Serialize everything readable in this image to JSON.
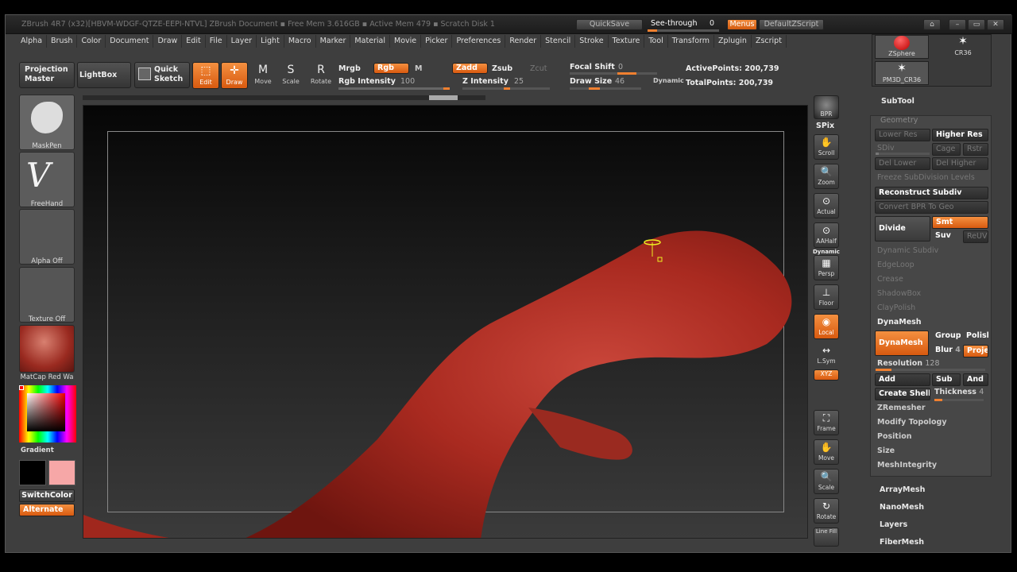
{
  "window_title": "ZBrush 4R7 (x32)[HBVM-WDGF-QTZE-EEPI-NTVL]    ZBrush Document    ▪ Free Mem 3.616GB ▪ Active Mem 479 ▪ Scratch Disk 1",
  "titlebar": {
    "quicksave": "QuickSave",
    "see_through": "See-through",
    "see_through_value": "0",
    "menus": "Menus",
    "default_zscript": "DefaultZScript"
  },
  "menu": [
    "Alpha",
    "Brush",
    "Color",
    "Document",
    "Draw",
    "Edit",
    "File",
    "Layer",
    "Light",
    "Macro",
    "Marker",
    "Material",
    "Movie",
    "Picker",
    "Preferences",
    "Render",
    "Stencil",
    "Stroke",
    "Texture",
    "Tool",
    "Transform",
    "Zplugin",
    "Zscript"
  ],
  "top_shelf": {
    "projection_master": [
      "Projection",
      "Master"
    ],
    "lightbox": "LightBox",
    "quick_sketch": [
      "Quick",
      "Sketch"
    ],
    "edit": "Edit",
    "draw": "Draw",
    "move": "Move",
    "scale": "Scale",
    "rotate": "Rotate",
    "mrgb": "Mrgb",
    "rgb": "Rgb",
    "m": "M",
    "rgb_intensity_label": "Rgb Intensity",
    "rgb_intensity_value": "100",
    "zadd": "Zadd",
    "zsub": "Zsub",
    "zcut": "Zcut",
    "z_intensity_label": "Z Intensity",
    "z_intensity_value": "25",
    "focal_shift_label": "Focal Shift",
    "focal_shift_value": "0",
    "draw_size_label": "Draw Size",
    "draw_size_value": "46",
    "dynamic": "Dynamic",
    "active_points": "ActivePoints: 200,739",
    "total_points": "TotalPoints: 200,739"
  },
  "left_tray": {
    "brush": "MaskPen",
    "stroke": "FreeHand",
    "alpha": "Alpha Off",
    "texture": "Texture Off",
    "material": "MatCap Red Wa",
    "gradient": "Gradient",
    "switchcolor": "SwitchColor",
    "alternate": "Alternate"
  },
  "right_shelf": {
    "bpr": "BPR",
    "spix": "SPix",
    "scroll": "Scroll",
    "zoom": "Zoom",
    "actual": "Actual",
    "aahalf": "AAHalf",
    "dynamic": "Dynamic",
    "persp": "Persp",
    "floor": "Floor",
    "local": "Local",
    "lsym": "L.Sym",
    "xyz": "XYZ",
    "frame": "Frame",
    "move": "Move",
    "scale": "Scale",
    "rotate": "Rotate",
    "linefill": "Line Fill"
  },
  "tool_panel": {
    "tool1": "ZSphere",
    "tool2": "CR36",
    "tool3": "PM3D_CR36",
    "subtool": "SubTool",
    "geometry": "Geometry",
    "lower_res": "Lower Res",
    "higher_res": "Higher Res",
    "sdiv": "SDiv",
    "cage": "Cage",
    "rstr": "Rstr",
    "del_lower": "Del Lower",
    "del_higher": "Del Higher",
    "freeze": "Freeze SubDivision Levels",
    "reconstruct": "Reconstruct Subdiv",
    "convert_bpr": "Convert BPR To Geo",
    "divide": "Divide",
    "smt": "Smt",
    "suv": "Suv",
    "reuv": "ReUV",
    "dynamic_subdiv": "Dynamic Subdiv",
    "edgeloop": "EdgeLoop",
    "crease": "Crease",
    "shadowbox": "ShadowBox",
    "claypolish": "ClayPolish",
    "dynamesh_section": "DynaMesh",
    "dynamesh_btn": "DynaMesh",
    "group": "Group",
    "polish": "Polish",
    "blur": "Blur",
    "blur_value": "4",
    "project": "Project",
    "resolution_label": "Resolution",
    "resolution_value": "128",
    "add": "Add",
    "sub": "Sub",
    "and": "And",
    "create_shell": "Create Shell",
    "thickness_label": "Thickness",
    "thickness_value": "4",
    "zremesher": "ZRemesher",
    "modify_topology": "Modify Topology",
    "position": "Position",
    "size": "Size",
    "meshintegrity": "MeshIntegrity",
    "arraymesh": "ArrayMesh",
    "nanomesh": "NanoMesh",
    "layers": "Layers",
    "fibermesh": "FiberMesh"
  },
  "colors": {
    "accent": "#f08030",
    "model": "#b02a20",
    "bg": "#3e3e3e"
  }
}
